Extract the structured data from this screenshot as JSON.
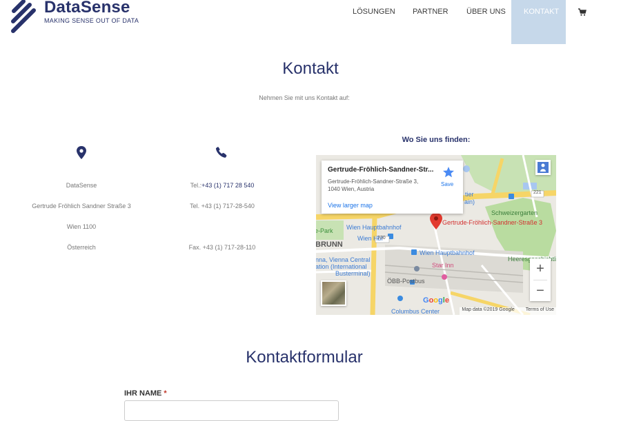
{
  "brand": {
    "name": "DataSense",
    "tagline": "MAKING SENSE OUT OF DATA",
    "color": "#28326b"
  },
  "nav": {
    "items": [
      {
        "label": "LÖSUNGEN"
      },
      {
        "label": "PARTNER"
      },
      {
        "label": "ÜBER UNS"
      },
      {
        "label": "KONTAKT",
        "active": true
      }
    ],
    "active_bg": "#c6d8ea",
    "cart_icon": "shopping-cart-icon"
  },
  "page": {
    "title": "Kontakt",
    "subtitle": "Nehmen Sie mit uns Kontakt auf:"
  },
  "address": {
    "icon": "map-marker-icon",
    "lines": [
      "DataSense",
      "Gertrude Fröhlich Sandner Straße 3",
      "Wien 1100",
      "Österreich"
    ]
  },
  "phone": {
    "icon": "phone-icon",
    "tel_prefix": "Tel.:",
    "tel_link": "+43 (1) 717 28 540",
    "tel2": "Tel. +43 (1) 717-28-540",
    "fax": "Fax. +43 (1) 717-28-110"
  },
  "map": {
    "heading": "Wo Sie uns finden:",
    "place_title": "Gertrude-Fröhlich-Sandner-Str...",
    "address_line1": "Gertrude-Fröhlich-Sandner-Straße 3,",
    "address_line2": "1040 Wien, Austria",
    "save_label": "Save",
    "larger_link": "View larger map",
    "pin_label": "Gertrude-Fröhlich-Sandner-Straße 3",
    "labels": {
      "wien_hauptbahnhof_1": "Wien Hauptbahnhof",
      "wien_hbf": "Wien Hbf",
      "road_230": "230",
      "road_221": "221",
      "brunn": "BRUNN",
      "park": "e-Park",
      "wien_hauptbahnhof_2": "Wien Hauptbahnhof",
      "vienna_central_1": "nna, Vienna Central",
      "vienna_central_2": "ation (International",
      "vienna_central_3": "Busterminal)",
      "schweizergarten": "Schweizergarten",
      "heeres": "Heeresgeschichtliches",
      "star_inn": "Star Inn",
      "oebb": "ÖBB-Postbus",
      "columbus": "Columbus Center",
      "tier": "tier",
      "ain": "ain)",
      "google": "Google"
    },
    "zoom_in": "+",
    "zoom_out": "−",
    "map_data": "Map data ©2019 Google",
    "terms": "Terms of Use"
  },
  "form": {
    "title": "Kontaktformular",
    "name_label": "IHR NAME",
    "required_mark": "*",
    "name_value": ""
  }
}
